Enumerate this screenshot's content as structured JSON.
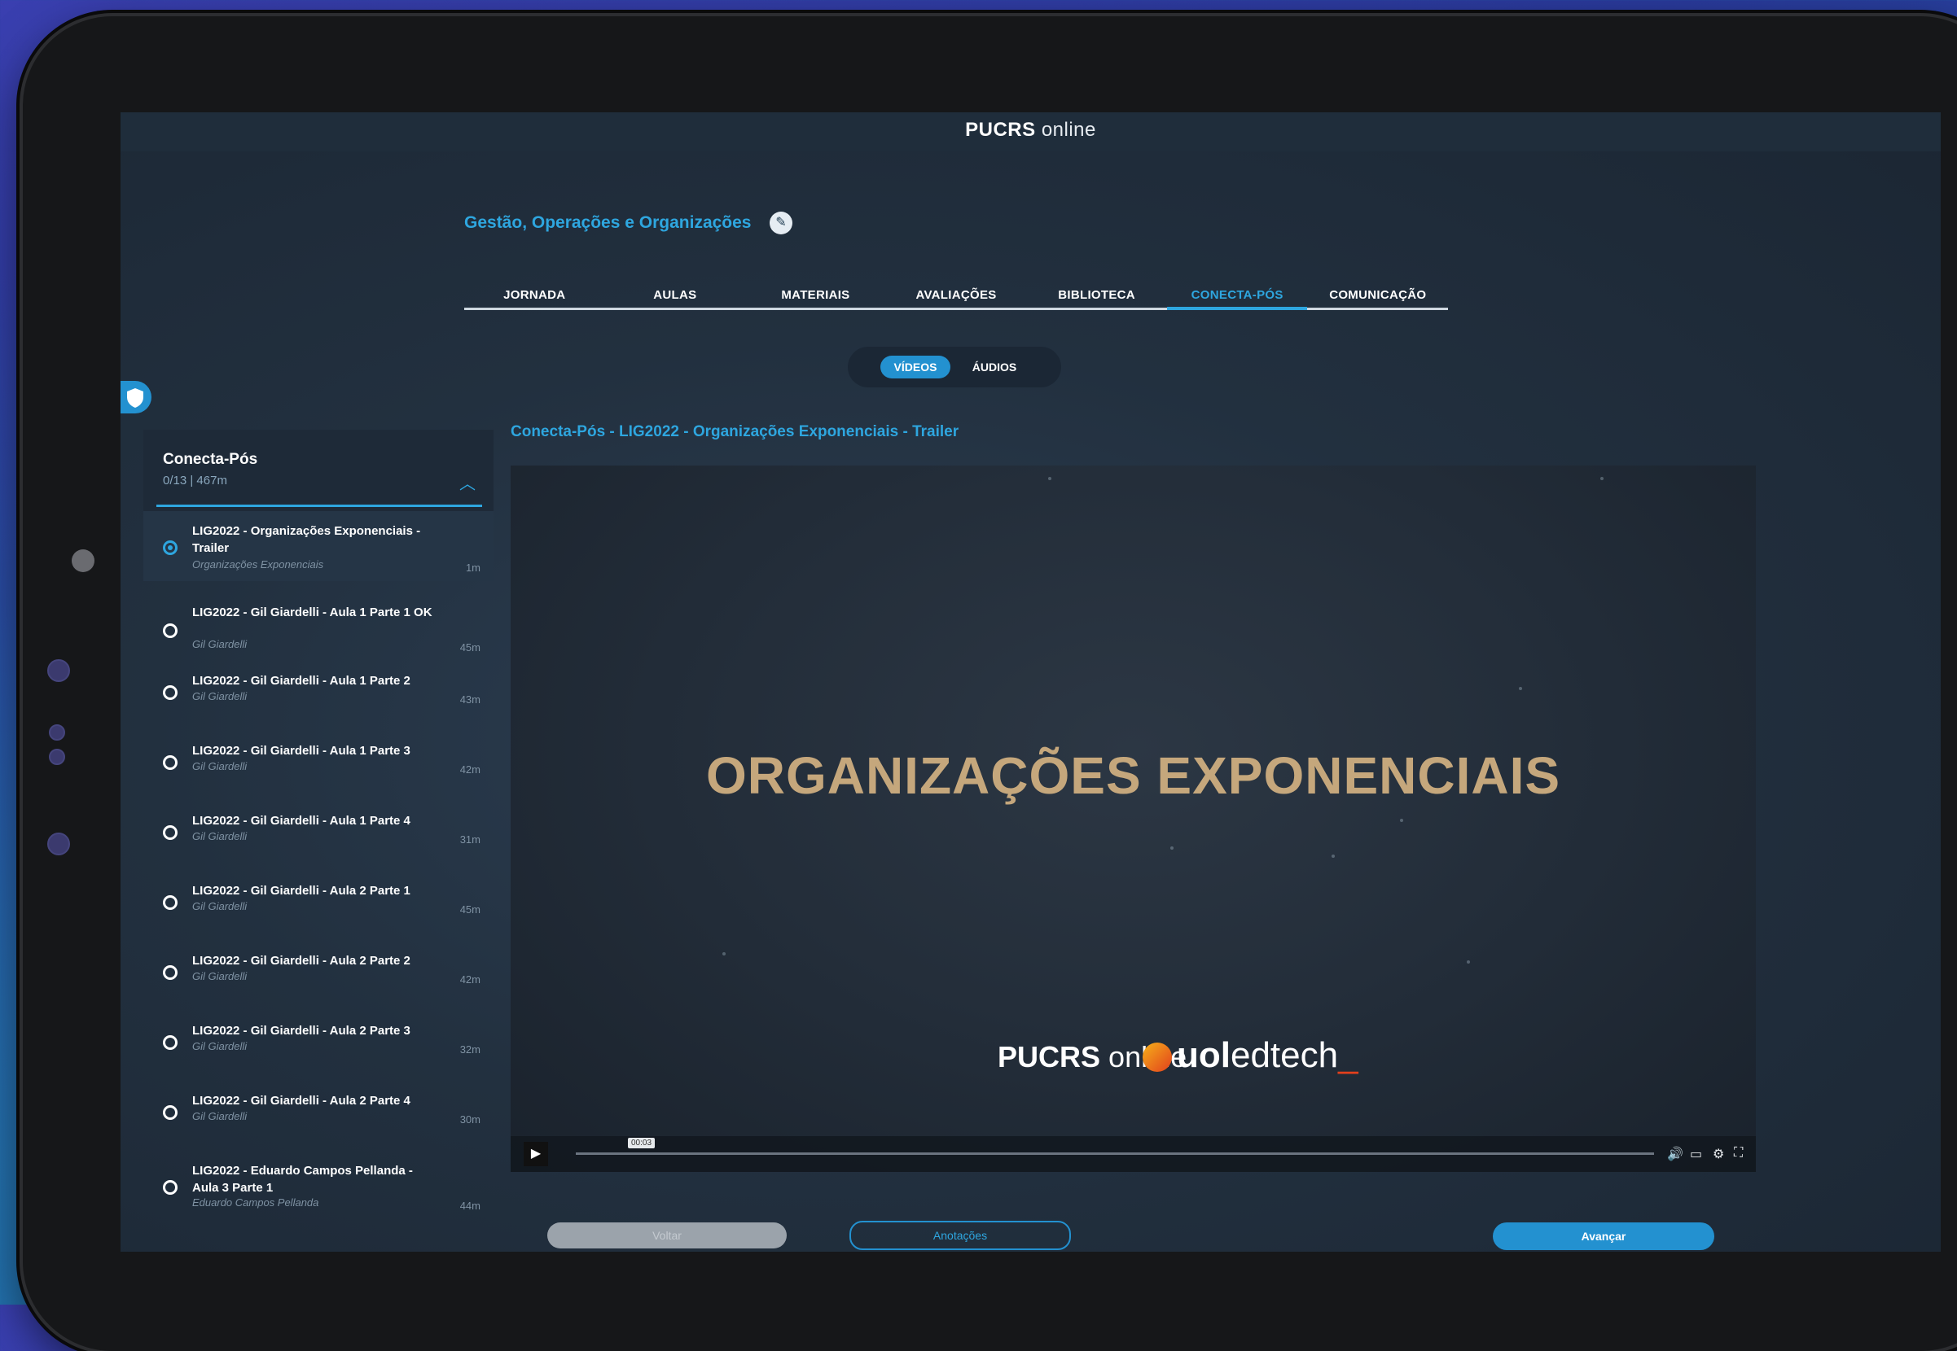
{
  "header": {
    "logo_bold": "PUCRS",
    "logo_light": "online"
  },
  "course": {
    "title": "Gestão, Operações e Organizações"
  },
  "tabs": [
    {
      "label": "JORNADA"
    },
    {
      "label": "AULAS"
    },
    {
      "label": "MATERIAIS"
    },
    {
      "label": "AVALIAÇÕES"
    },
    {
      "label": "BIBLIOTECA"
    },
    {
      "label": "CONECTA-PÓS",
      "active": true
    },
    {
      "label": "COMUNICAÇÃO"
    }
  ],
  "media_toggle": {
    "videos": "VÍDEOS",
    "audios": "ÁUDIOS",
    "selected": "VÍDEOS"
  },
  "sidebar": {
    "title": "Conecta-Pós",
    "progress": "0/13 | 467m",
    "items": [
      {
        "title": "LIG2022 - Organizações Exponenciais - Trailer",
        "subtitle": "Organizações Exponenciais",
        "duration": "1m",
        "active": true
      },
      {
        "title": "LIG2022 - Gil Giardelli - Aula 1 Parte 1 OK",
        "subtitle": "Gil Giardelli",
        "duration": "45m"
      },
      {
        "title": "LIG2022 - Gil Giardelli - Aula 1 Parte 2",
        "subtitle": "Gil Giardelli",
        "duration": "43m"
      },
      {
        "title": "LIG2022 - Gil Giardelli - Aula 1 Parte 3",
        "subtitle": "Gil Giardelli",
        "duration": "42m"
      },
      {
        "title": "LIG2022 - Gil Giardelli - Aula 1 Parte 4",
        "subtitle": "Gil Giardelli",
        "duration": "31m"
      },
      {
        "title": "LIG2022 - Gil Giardelli - Aula 2 Parte 1",
        "subtitle": "Gil Giardelli",
        "duration": "45m"
      },
      {
        "title": "LIG2022 - Gil Giardelli - Aula 2 Parte 2",
        "subtitle": "Gil Giardelli",
        "duration": "42m"
      },
      {
        "title": "LIG2022 - Gil Giardelli - Aula 2 Parte 3",
        "subtitle": "Gil Giardelli",
        "duration": "32m"
      },
      {
        "title": "LIG2022 - Gil Giardelli - Aula 2 Parte 4",
        "subtitle": "Gil Giardelli",
        "duration": "30m"
      },
      {
        "title": "LIG2022 - Eduardo Campos Pellanda - Aula 3 Parte 1",
        "subtitle": "Eduardo Campos Pellanda",
        "duration": "44m"
      }
    ]
  },
  "video": {
    "title": "Conecta-Pós - LIG2022 - Organizações Exponenciais - Trailer",
    "frame_text": "ORGANIZAÇÕES EXPONENCIAIS",
    "frame_logo_pucrs_bold": "PUCRS",
    "frame_logo_pucrs_light": "online",
    "frame_logo_uol_bold": "uol",
    "frame_logo_uol_light": "edtech",
    "current_time": "00:03",
    "progress": 0.0,
    "icons": [
      "play-icon",
      "volume-icon",
      "captions-icon",
      "settings-icon",
      "fullscreen-icon"
    ]
  },
  "footer_buttons": {
    "back": "Voltar",
    "notes": "Anotações",
    "next": "Avançar"
  },
  "colors": {
    "accent": "#2ea6df",
    "button_blue": "#2391d0",
    "title_gold": "#c5a77c",
    "disabled": "#9ba3ab"
  }
}
